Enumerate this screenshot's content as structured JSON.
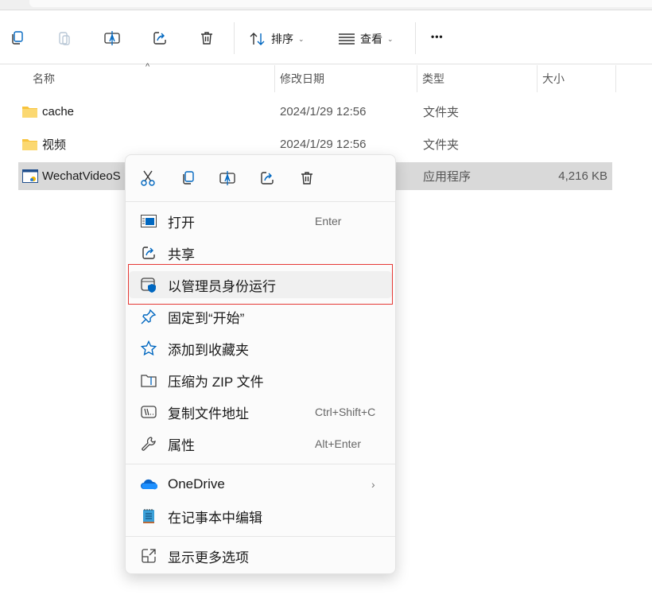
{
  "toolbar": {
    "sort_label": "排序",
    "view_label": "查看",
    "more_label": "•••"
  },
  "columns": {
    "name": "名称",
    "modified": "修改日期",
    "type": "类型",
    "size": "大小"
  },
  "files": [
    {
      "name": "cache",
      "modified": "2024/1/29 12:56",
      "type": "文件夹",
      "size": "",
      "icon": "folder-icon"
    },
    {
      "name": "视频",
      "modified": "2024/1/29 12:56",
      "type": "文件夹",
      "size": "",
      "icon": "folder-icon"
    },
    {
      "name": "WechatVideoS",
      "modified": "",
      "type": "应用程序",
      "size": "4,216 KB",
      "icon": "application-icon",
      "selected": true
    }
  ],
  "context_menu": {
    "top_icons": [
      "cut-icon",
      "copy-icon",
      "rename-icon",
      "share-icon",
      "delete-icon"
    ],
    "items": [
      {
        "label": "打开",
        "shortcut": "Enter",
        "icon": "open-icon"
      },
      {
        "label": "共享",
        "shortcut": "",
        "icon": "share-icon"
      },
      {
        "label": "以管理员身份运行",
        "shortcut": "",
        "icon": "admin-shield-icon",
        "highlighted": true
      },
      {
        "label": "固定到“开始”",
        "shortcut": "",
        "icon": "pin-icon"
      },
      {
        "label": "添加到收藏夹",
        "shortcut": "",
        "icon": "star-icon"
      },
      {
        "label": "压缩为 ZIP 文件",
        "shortcut": "",
        "icon": "zip-icon"
      },
      {
        "label": "复制文件地址",
        "shortcut": "Ctrl+Shift+C",
        "icon": "copy-path-icon"
      },
      {
        "label": "属性",
        "shortcut": "Alt+Enter",
        "icon": "wrench-icon"
      },
      {
        "label": "OneDrive",
        "shortcut": "",
        "icon": "onedrive-icon",
        "submenu": true
      },
      {
        "label": "在记事本中编辑",
        "shortcut": "",
        "icon": "notepad-icon"
      },
      {
        "label": "显示更多选项",
        "shortcut": "",
        "icon": "more-options-icon"
      }
    ]
  },
  "colors": {
    "accent": "#0067c0",
    "highlight_border": "#e53935",
    "selected_row": "#d9d9d9",
    "folder": "#f8c33c"
  }
}
